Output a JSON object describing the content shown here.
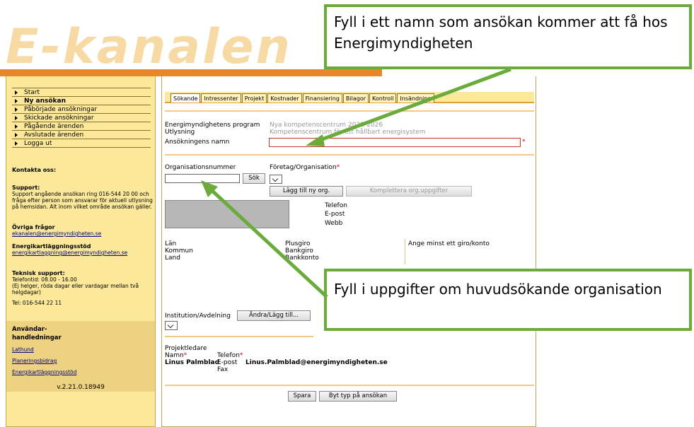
{
  "app": {
    "logo_text": "E-kanalen"
  },
  "sidebar": {
    "nav": [
      {
        "label": "Start",
        "bold": false
      },
      {
        "label": "Ny ansökan",
        "bold": true
      },
      {
        "label": "Påbörjade ansökningar",
        "bold": false
      },
      {
        "label": "Skickade ansökningar",
        "bold": false
      },
      {
        "label": "Pågående ärenden",
        "bold": false
      },
      {
        "label": "Avslutade ärenden",
        "bold": false
      },
      {
        "label": "Logga ut",
        "bold": false
      }
    ],
    "contact_heading": "Kontakta oss:",
    "support_heading": "Support:",
    "support_text": "Support angående ansökan ring 016-544 20 00 och fråga efter person som ansvarar för aktuell utlysning på hemsidan. Alt inom vilket område ansökan gäller.",
    "other_heading": "Övriga frågor",
    "other_email": "ekanalen@energimyndigheten.se",
    "energy_heading": "Energikartläggningsstöd",
    "energy_email": "energikartlaggning@energimyndigheten.se",
    "tech_heading": "Teknisk support:",
    "tech_hours": "Telefontid: 08.00 - 16.00",
    "tech_note": "(Ej helger, röda dagar eller vardagar mellan två helgdagar)",
    "tech_tel": "Tel: 016-544 22 11",
    "manuals_heading_1": "Användar-",
    "manuals_heading_2": "handledningar",
    "manual_links": [
      "Lathund",
      "Planeringsbidrag",
      "Energikartläggningsstöd"
    ],
    "version": "v.2.21.0.18949"
  },
  "tabs": [
    "Sökande",
    "Intressenter",
    "Projekt",
    "Kostnader",
    "Finansiering",
    "Bilagor",
    "Kontroll",
    "Insändning"
  ],
  "form": {
    "program_label": "Energimyndighetens program",
    "program_value": "Nya kompetenscentrum 2022-2026",
    "call_label": "Utlysning",
    "call_value": "Kompetenscentrum för ett hållbart energisystem",
    "name_label": "Ansökningens namn",
    "name_value": "",
    "orgnr_label": "Organisationsnummer",
    "company_label": "Företag/Organisation",
    "search_button": "Sök",
    "add_org_button": "Lägg till ny org.",
    "complete_org_button": "Komplettera org.uppgifter",
    "phone_label": "Telefon",
    "email_label": "E-post",
    "web_label": "Webb",
    "county_label": "Län",
    "municipality_label": "Kommun",
    "country_label": "Land",
    "plusgiro_label": "Plusgiro",
    "bankgiro_label": "Bankgiro",
    "bankaccount_label": "Bankkonto",
    "giro_hint": "Ange minst ett giro/konto",
    "institution_label": "Institution/Avdelning",
    "institution_button": "Ändra/Lägg till...",
    "leader_heading": "Projektledare",
    "leader_name_label": "Namn",
    "leader_phone_label": "Telefon",
    "leader_name": "Linus Palmblad",
    "leader_email_label": "E-post",
    "leader_email": "Linus.Palmblad@energimyndigheten.se",
    "leader_fax_label": "Fax",
    "save_button": "Spara",
    "change_type_button": "Byt typ på ansökan"
  },
  "callouts": {
    "top": "Fyll i ett namn som ansökan kommer att få hos Energimyndigheten",
    "bottom": "Fyll i uppgifter om huvudsökande organisation"
  },
  "colors": {
    "orange_band": "#e8872a",
    "sidebar": "#fbe89a",
    "callout_border": "#6aab3b",
    "required": "#e00000"
  }
}
